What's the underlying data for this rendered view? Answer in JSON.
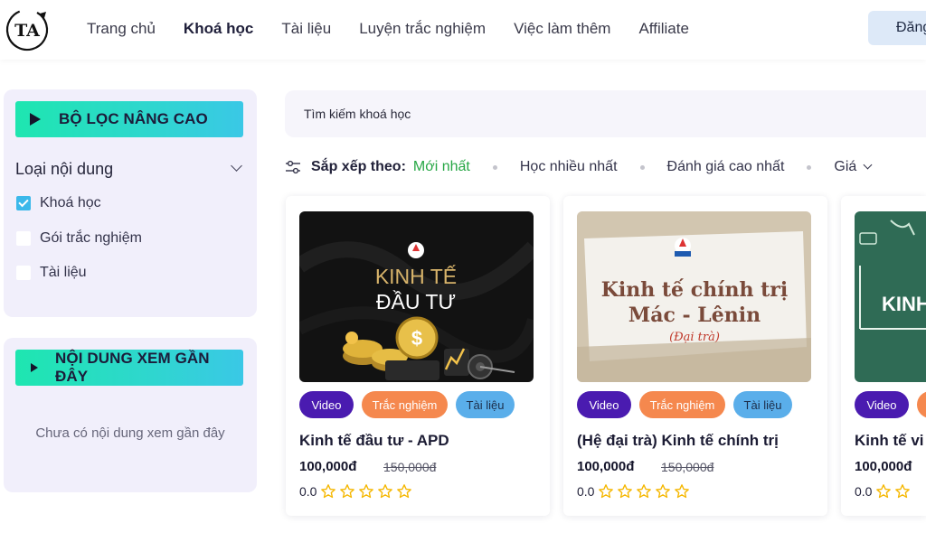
{
  "header": {
    "logo_text": "TA",
    "nav": [
      "Trang chủ",
      "Khoá học",
      "Tài liệu",
      "Luyện trắc nghiệm",
      "Việc làm thêm",
      "Affiliate"
    ],
    "login_label": "Đăng"
  },
  "sidebar": {
    "filter_button": "BỘ LỌC NÂNG CAO",
    "content_type_title": "Loại nội dung",
    "options": [
      {
        "label": "Khoá học",
        "checked": true
      },
      {
        "label": "Gói trắc nghiệm",
        "checked": false
      },
      {
        "label": "Tài liệu",
        "checked": false
      }
    ],
    "recent_button": "NỘI DUNG XEM GẦN ĐÂY",
    "recent_empty": "Chưa có nội dung xem gần đây"
  },
  "search": {
    "placeholder": "Tìm kiếm khoá học"
  },
  "sort": {
    "label": "Sắp xếp theo:",
    "options": [
      "Mới nhất",
      "Học nhiều nhất",
      "Đánh giá cao nhất",
      "Giá"
    ],
    "active": "Mới nhất"
  },
  "tags": {
    "video": "Video",
    "quiz": "Trắc nghiệm",
    "doc": "Tài liệu"
  },
  "courses": [
    {
      "thumb_line1": "KINH TẾ",
      "thumb_line2": "ĐẦU TƯ",
      "title": "Kinh tế đầu tư - APD",
      "price": "100,000đ",
      "old_price": "150,000đ",
      "rating": "0.0"
    },
    {
      "thumb_line1": "Kinh tế chính trị",
      "thumb_line2": "Mác - Lênin",
      "thumb_line3": "(Đại trà)",
      "title": "(Hệ đại trà) Kinh tế chính trị",
      "price": "100,000đ",
      "old_price": "150,000đ",
      "rating": "0.0"
    },
    {
      "thumb_line1": "KINH",
      "title": "Kinh tế vi mô",
      "price": "100,000đ",
      "rating": "0.0"
    }
  ],
  "colors": {
    "accent_green": "#27a745",
    "video_tag": "#4a1bb0",
    "quiz_tag": "#f5884e",
    "doc_tag": "#5aaeea",
    "star": "#f5b700"
  }
}
